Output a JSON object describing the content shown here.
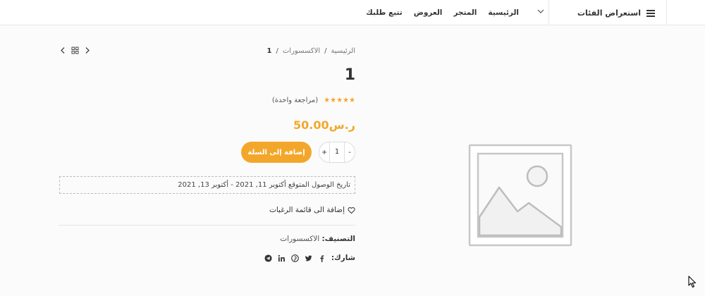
{
  "header": {
    "browse_label": "استعراض الفئات",
    "nav": [
      "الرئيسية",
      "المتجر",
      "العروض",
      "تتبع طلبك"
    ]
  },
  "breadcrumb": {
    "home": "الرئيسية",
    "category": "الاكسسورات",
    "current": "1",
    "separator": "/"
  },
  "product": {
    "title": "1",
    "stars": "★★★★★",
    "rating_value": 5,
    "rating_max": 5,
    "reviews_label": "(مراجعة واحدة)",
    "price": "ر.س50.00",
    "quantity": "1",
    "qty_minus": "-",
    "qty_plus": "+",
    "add_to_cart_label": "إضافة إلى السلة",
    "delivery_text": "تاريخ الوصول المتوقع أكتوبر 11, 2021 - أكتوبر 13, 2021",
    "wishlist_label": "إضافة الى قائمة الرغبات",
    "category_label": "التصنيف:",
    "category_value": "الاكسسورات",
    "share_label": "شارك:"
  },
  "colors": {
    "accent": "#f3a72a",
    "text": "#333333",
    "muted": "#777777",
    "border": "#e8e8e8",
    "background": "#fbfbfb"
  },
  "icons": {
    "menu": "hamburger-icon",
    "dropdown": "chevron-down-icon",
    "share": [
      "telegram-icon",
      "pinterest-icon",
      "linkedin-icon",
      "twitter-icon",
      "facebook-icon"
    ]
  }
}
